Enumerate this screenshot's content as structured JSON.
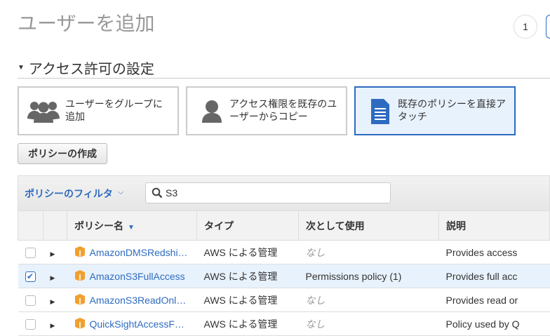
{
  "header": {
    "title": "ユーザーを追加",
    "steps": [
      "1"
    ]
  },
  "section": {
    "title": "アクセス許可の設定"
  },
  "options": [
    {
      "label": "ユーザーをグループに追加",
      "icon": "group-icon",
      "selected": false
    },
    {
      "label": "アクセス権限を既存のユーザーからコピー",
      "icon": "user-icon",
      "selected": false
    },
    {
      "label": "既存のポリシーを直接アタッチ",
      "icon": "document-icon",
      "selected": true
    }
  ],
  "create_policy_label": "ポリシーの作成",
  "filter": {
    "label": "ポリシーのフィルタ",
    "search_value": "S3"
  },
  "table": {
    "columns": [
      "",
      "",
      "ポリシー名",
      "タイプ",
      "次として使用",
      "説明"
    ],
    "rows": [
      {
        "checked": false,
        "name": "AmazonDMSRedshi…",
        "type": "AWS による管理",
        "used_as": "なし",
        "desc": "Provides access"
      },
      {
        "checked": true,
        "name": "AmazonS3FullAccess",
        "type": "AWS による管理",
        "used_as": "Permissions policy (1)",
        "desc": "Provides full acc"
      },
      {
        "checked": false,
        "name": "AmazonS3ReadOnl…",
        "type": "AWS による管理",
        "used_as": "なし",
        "desc": "Provides read or"
      },
      {
        "checked": false,
        "name": "QuickSightAccessF…",
        "type": "AWS による管理",
        "used_as": "なし",
        "desc": "Policy used by Q"
      }
    ]
  },
  "colors": {
    "accent": "#2e6bc0",
    "selected_bg": "#e8f2fc",
    "icon_orange": "#f0a030"
  }
}
